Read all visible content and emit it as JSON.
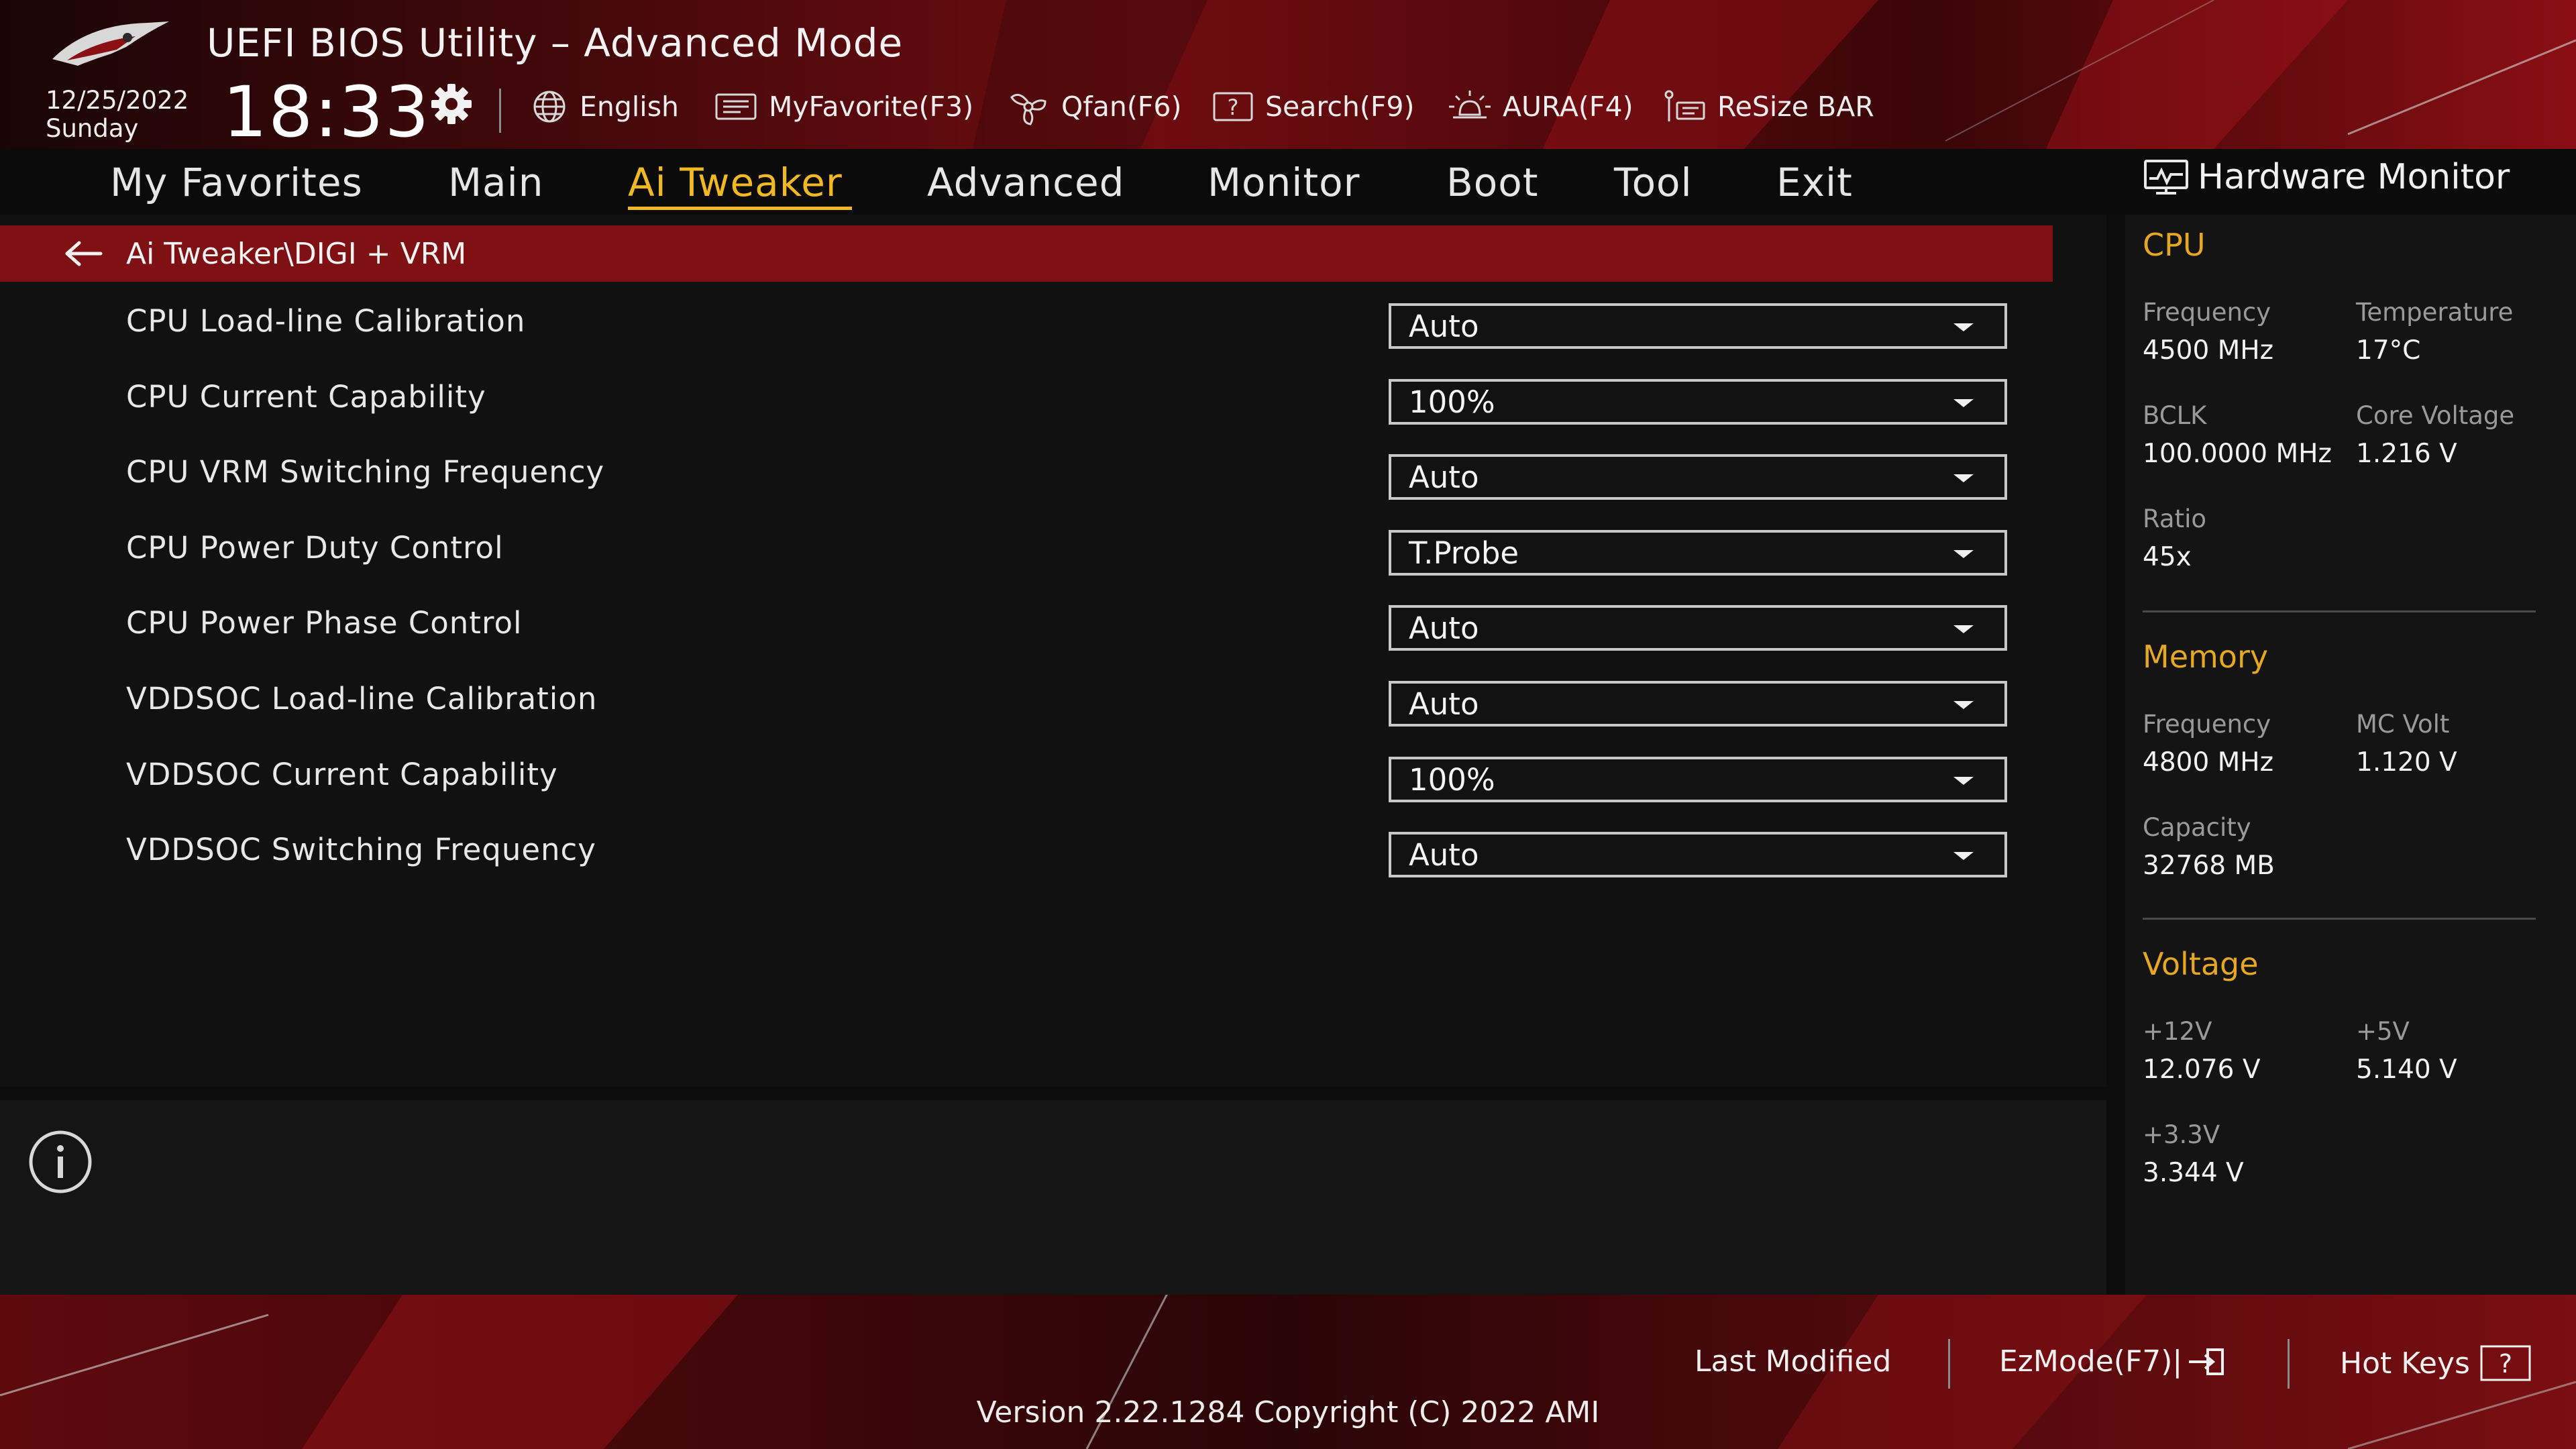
{
  "header": {
    "title": "UEFI BIOS Utility – Advanced Mode",
    "date": "12/25/2022",
    "day": "Sunday",
    "time": "18:33",
    "toolbar": [
      {
        "label": "English",
        "icon": "globe-icon"
      },
      {
        "label": "MyFavorite(F3)",
        "icon": "favorite-icon"
      },
      {
        "label": "Qfan(F6)",
        "icon": "fan-icon"
      },
      {
        "label": "Search(F9)",
        "icon": "search-icon"
      },
      {
        "label": "AURA(F4)",
        "icon": "aura-icon"
      },
      {
        "label": "ReSize BAR",
        "icon": "resize-bar-icon"
      }
    ]
  },
  "nav": {
    "tabs": [
      "My Favorites",
      "Main",
      "Ai Tweaker",
      "Advanced",
      "Monitor",
      "Boot",
      "Tool",
      "Exit"
    ],
    "active": "Ai Tweaker"
  },
  "breadcrumb": "Ai Tweaker\\DIGI + VRM",
  "settings": [
    {
      "label": "CPU Load-line Calibration",
      "value": "Auto"
    },
    {
      "label": "CPU Current Capability",
      "value": "100%"
    },
    {
      "label": "CPU VRM Switching Frequency",
      "value": "Auto"
    },
    {
      "label": "CPU Power Duty Control",
      "value": "T.Probe"
    },
    {
      "label": "CPU Power Phase Control",
      "value": "Auto"
    },
    {
      "label": "VDDSOC Load-line Calibration",
      "value": "Auto"
    },
    {
      "label": "VDDSOC Current Capability",
      "value": "100%"
    },
    {
      "label": "VDDSOC Switching Frequency",
      "value": "Auto"
    }
  ],
  "hw_monitor": {
    "title": "Hardware Monitor",
    "cpu": {
      "heading": "CPU",
      "frequency_label": "Frequency",
      "frequency": "4500 MHz",
      "temperature_label": "Temperature",
      "temperature": "17°C",
      "bclk_label": "BCLK",
      "bclk": "100.0000 MHz",
      "core_voltage_label": "Core Voltage",
      "core_voltage": "1.216 V",
      "ratio_label": "Ratio",
      "ratio": "45x"
    },
    "memory": {
      "heading": "Memory",
      "frequency_label": "Frequency",
      "frequency": "4800 MHz",
      "mc_volt_label": "MC Volt",
      "mc_volt": "1.120 V",
      "capacity_label": "Capacity",
      "capacity": "32768 MB"
    },
    "voltage": {
      "heading": "Voltage",
      "v12_label": "+12V",
      "v12": "12.076 V",
      "v5_label": "+5V",
      "v5": "5.140 V",
      "v33_label": "+3.3V",
      "v33": "3.344 V"
    }
  },
  "footer": {
    "last_modified": "Last Modified",
    "ezmode": "EzMode(F7)|",
    "hotkeys": "Hot Keys",
    "version": "Version 2.22.1284 Copyright (C) 2022 AMI"
  },
  "colors": {
    "accent": "#f0b823",
    "section": "#e6a823",
    "breadcrumb_bg": "#7f1114",
    "background": "#0c0c0d"
  }
}
